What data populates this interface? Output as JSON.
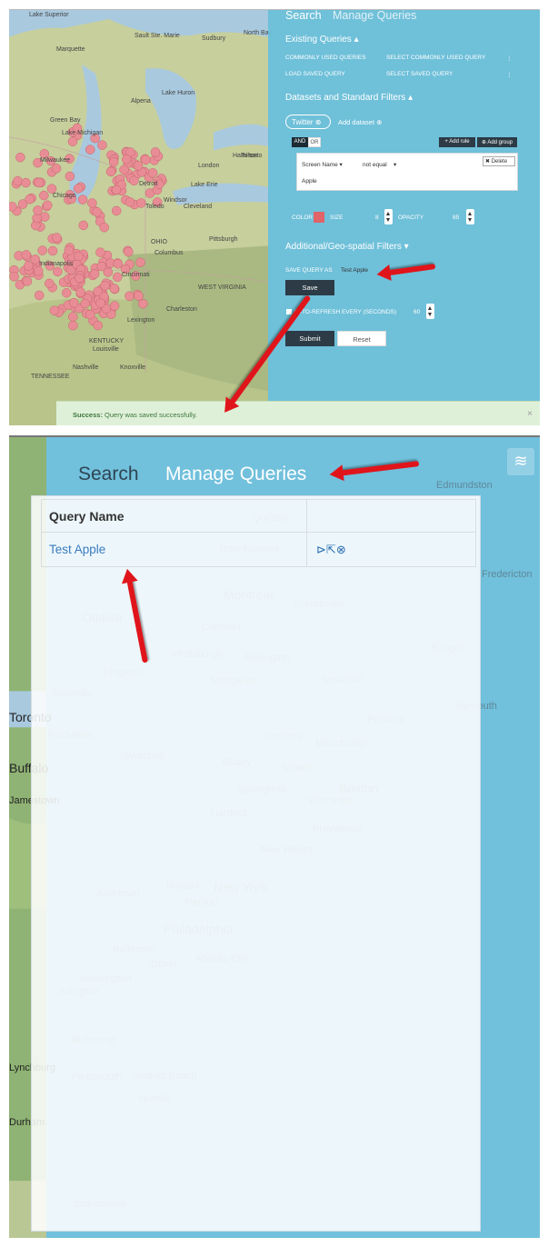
{
  "colors": {
    "panel_blue": "#69bede",
    "success_bg": "#dff0d8",
    "marker": "#e88d95",
    "arrow": "#e0151b",
    "dark_button": "#2c3b46"
  },
  "panel1": {
    "map_labels": [
      "Lake Superior",
      "Marquette",
      "Sault Ste. Marie",
      "North Bay",
      "Sudbury",
      "Lake Huron",
      "Lake Michigan",
      "Green Bay",
      "Alpena",
      "Toronto",
      "Milwaukee",
      "Chicago",
      "Detroit",
      "Windsor",
      "Toledo",
      "Cleveland",
      "Pittsburgh",
      "Columbus",
      "Cincinnati",
      "Indianapolis",
      "OHIO",
      "Lexington",
      "Louisville",
      "WEST VIRGINIA",
      "KENTUCKY",
      "Nashville",
      "Knoxville",
      "TENNESSEE",
      "Hamilton",
      "London",
      "Lake Erie",
      "Charleston"
    ],
    "side": {
      "tab_search": "Search",
      "tab_manage": "Manage Queries",
      "existing_queries": "Existing Queries",
      "commonly_used": "COMMONLY USED QUERIES",
      "commonly_used_select": "SELECT COMMONLY USED QUERY",
      "load_saved": "LOAD SAVED QUERY",
      "load_saved_select": "SELECT SAVED QUERY",
      "datasets": "Datasets and Standard Filters",
      "dataset_pill": "Twitter",
      "add_dataset": "Add dataset",
      "and": "AND",
      "or": "OR",
      "add_rule": "Add rule",
      "add_group": "Add group",
      "rule_field": "Screen Name",
      "rule_op": "not equal",
      "rule_value": "Apple",
      "delete": "Delete",
      "color_label": "COLOR",
      "size_label": "SIZE",
      "size_value": "8",
      "opacity_label": "OPACITY",
      "opacity_value": "85",
      "geo_filters": "Additional/Geo-spatial Filters",
      "save_as_label": "SAVE QUERY AS",
      "save_as_value": "Test Apple",
      "save_btn": "Save",
      "auto_refresh": "AUTO-REFRESH EVERY (SECONDS)",
      "refresh_value": "60",
      "submit": "Submit",
      "reset": "Reset"
    },
    "success": {
      "strong": "Success:",
      "text": " Query was saved successfully.",
      "close": "×"
    }
  },
  "panel2": {
    "map_labels": [
      "Quebec",
      "Trois-Rivieres",
      "Montreal",
      "Ottawa",
      "Sherbrooke",
      "Cornwall",
      "Kingston",
      "Plattsburgh",
      "Burlington",
      "Montpelier",
      "Lewiston",
      "Bangor",
      "Portland",
      "Concord",
      "Manchester",
      "Albany",
      "Syracuse",
      "Rochester",
      "Lowell",
      "Boston",
      "Worcester",
      "Springfield",
      "Hartford",
      "Providence",
      "New Haven",
      "Newark",
      "New York",
      "Allentown",
      "Trenton",
      "Philadelphia",
      "Baltimore",
      "Dover",
      "Atlantic City",
      "Washington",
      "Arlington",
      "Richmond",
      "Portsmouth",
      "Virginia Beach",
      "Norfolk",
      "Durham",
      "Jacksonville",
      "Edmundston",
      "Fredericton",
      "Yarmouth",
      "Toronto",
      "Buffalo",
      "Jamestown",
      "Belleville",
      "Lynchburg"
    ],
    "tab_search": "Search",
    "tab_manage": "Manage Queries",
    "table": {
      "col_name": "Query Name",
      "rows": [
        {
          "name": "Test Apple"
        }
      ]
    }
  }
}
